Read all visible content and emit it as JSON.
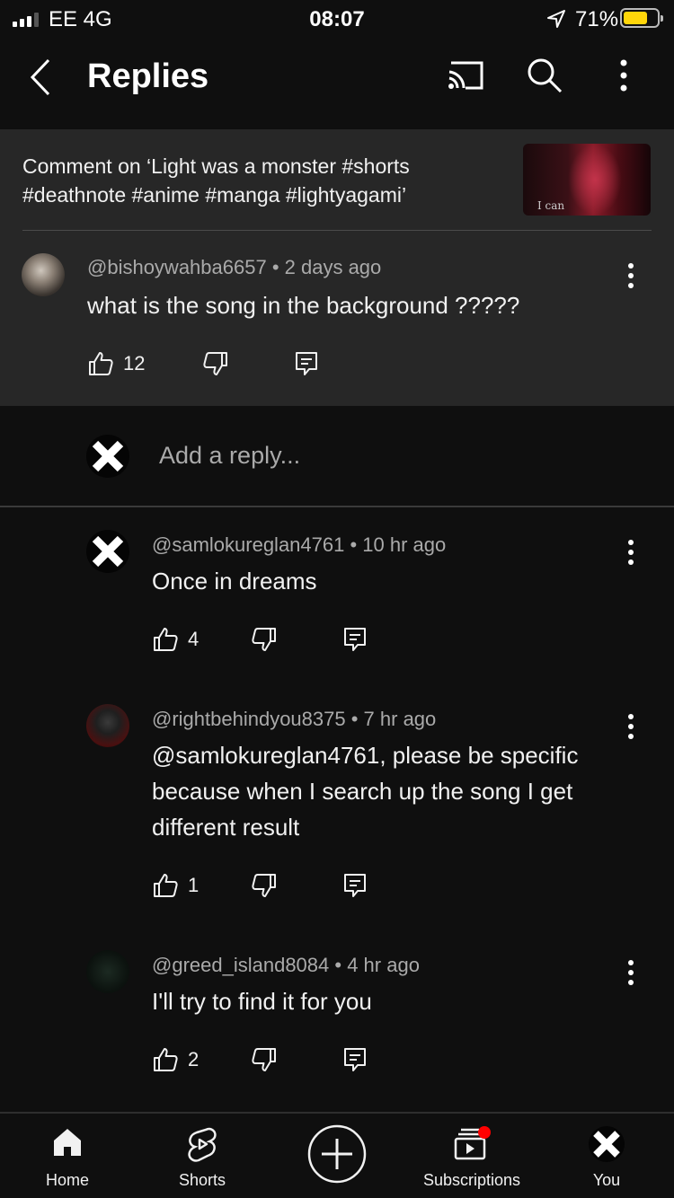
{
  "status_bar": {
    "carrier": "EE  4G",
    "time": "08:07",
    "battery": "71%",
    "battery_color": "#ffd60a"
  },
  "header": {
    "title": "Replies",
    "icons": [
      "back-icon",
      "cast-icon",
      "search-icon",
      "more-icon"
    ]
  },
  "parent": {
    "context": "Comment on ‘Light was a monster #shorts #deathnote #anime #manga #lightyagami’",
    "thumbnail_text": "I can",
    "comment": {
      "author": "@bishoywahba6657",
      "age": "2 days ago",
      "text": "what is the song in the background ?????",
      "likes": "12"
    }
  },
  "add_reply": {
    "placeholder": "Add a reply..."
  },
  "replies": [
    {
      "author": "@samlokureglan4761",
      "age": "10 hr ago",
      "text": "Once in dreams",
      "likes": "4"
    },
    {
      "author": "@rightbehindyou8375",
      "age": "7 hr ago",
      "text": "@samlokureglan4761, please be specific because when I search up the song I get different result",
      "likes": "1"
    },
    {
      "author": "@greed_island8084",
      "age": "4 hr ago",
      "text": "I'll try to find it for you",
      "likes": "2"
    }
  ],
  "nav": {
    "items": [
      {
        "label": "Home",
        "icon": "home-icon"
      },
      {
        "label": "Shorts",
        "icon": "shorts-icon"
      },
      {
        "label": "",
        "icon": "create-icon"
      },
      {
        "label": "Subscriptions",
        "icon": "subscriptions-icon"
      },
      {
        "label": "You",
        "icon": "you-avatar"
      }
    ],
    "notification_color": "#ff0000"
  }
}
